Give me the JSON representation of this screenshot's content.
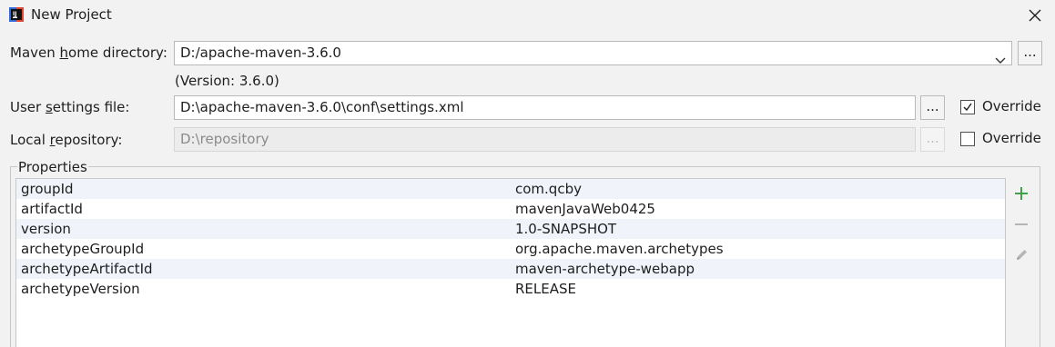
{
  "window": {
    "title": "New Project"
  },
  "maven_home": {
    "label_pre": "Maven ",
    "label_mnemonic": "h",
    "label_post": "ome directory:",
    "value": "D:/apache-maven-3.6.0",
    "version_note": "(Version: 3.6.0)",
    "browse_label": "..."
  },
  "user_settings": {
    "label_pre": "User ",
    "label_mnemonic": "s",
    "label_post": "ettings file:",
    "value": "D:\\apache-maven-3.6.0\\conf\\settings.xml",
    "browse_label": "...",
    "override_label": "Override",
    "override_checked": true
  },
  "local_repo": {
    "label_pre": "Local ",
    "label_mnemonic": "r",
    "label_post": "epository:",
    "value": "D:\\repository",
    "browse_label": "...",
    "override_label": "Override",
    "override_checked": false
  },
  "properties": {
    "legend": "Properties",
    "rows": [
      {
        "key": "groupId",
        "value": "com.qcby"
      },
      {
        "key": "artifactId",
        "value": "mavenJavaWeb0425"
      },
      {
        "key": "version",
        "value": "1.0-SNAPSHOT"
      },
      {
        "key": "archetypeGroupId",
        "value": "org.apache.maven.archetypes"
      },
      {
        "key": "archetypeArtifactId",
        "value": "maven-archetype-webapp"
      },
      {
        "key": "archetypeVersion",
        "value": "RELEASE"
      }
    ],
    "add_icon": "plus-icon",
    "remove_icon": "minus-icon",
    "edit_icon": "pencil-icon"
  },
  "colors": {
    "add_green": "#3fa14a",
    "disabled_gray": "#b5b5b5"
  }
}
